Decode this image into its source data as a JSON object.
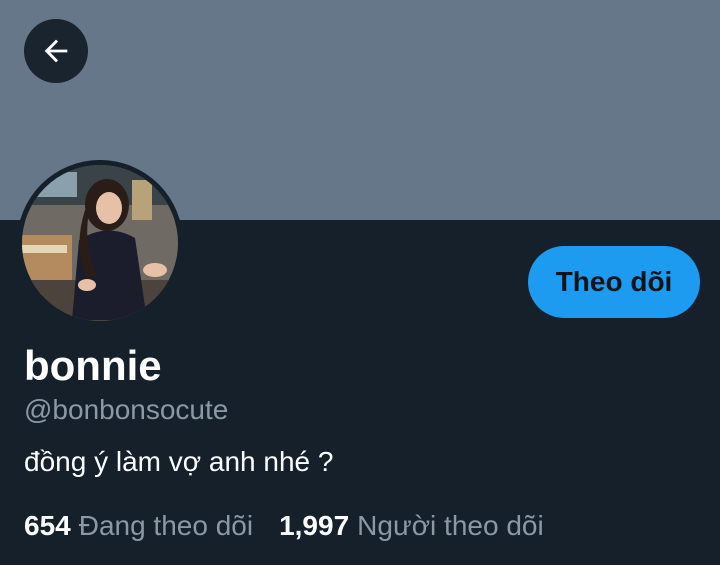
{
  "header": {
    "back_icon": "arrow-left-icon"
  },
  "colors": {
    "banner": "#66778a",
    "background": "#15202b",
    "accent": "#1d9bf0"
  },
  "profile": {
    "display_name": "bonnie",
    "handle": "@bonbonsocute",
    "bio": "đồng ý làm vợ anh nhé ?",
    "follow_label": "Theo dõi"
  },
  "stats": {
    "following_count": "654",
    "following_label": "Đang theo dõi",
    "followers_count": "1,997",
    "followers_label": "Người theo dõi"
  }
}
